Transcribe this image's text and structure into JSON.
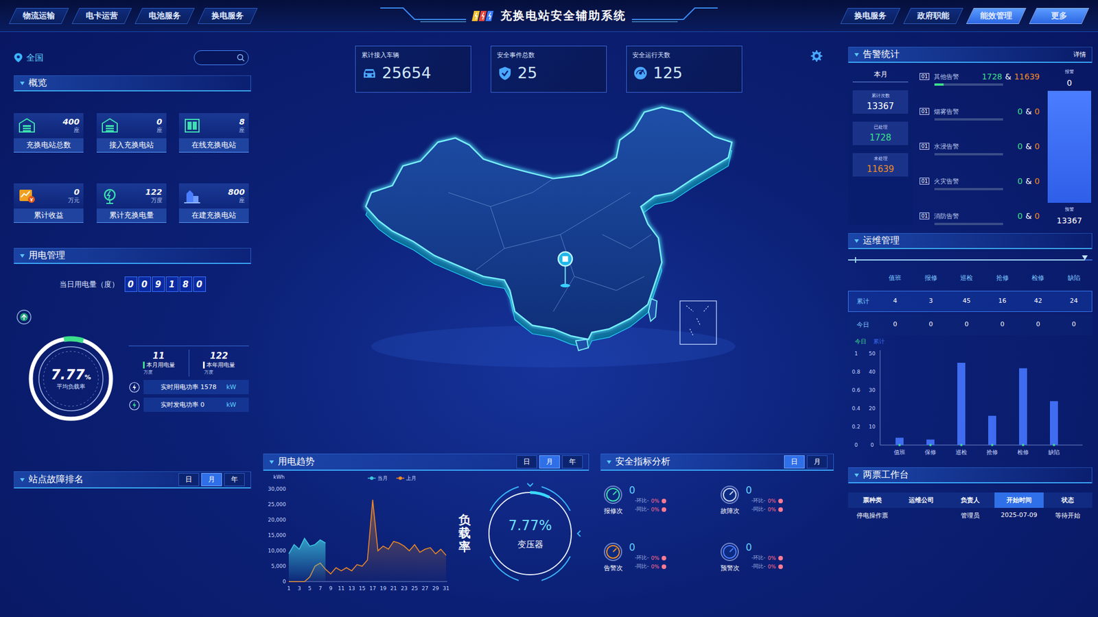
{
  "header": {
    "title": "充换电站安全辅助系统",
    "left_tabs": [
      {
        "label": "物流运输",
        "selected": false
      },
      {
        "label": "电卡运营",
        "selected": false
      },
      {
        "label": "电池服务",
        "selected": false
      },
      {
        "label": "换电服务",
        "selected": false
      }
    ],
    "right_tabs": [
      {
        "label": "换电服务",
        "selected": false
      },
      {
        "label": "政府职能",
        "selected": false
      },
      {
        "label": "能效管理",
        "selected": true
      },
      {
        "label": "更多",
        "selected": true
      }
    ]
  },
  "location": {
    "label": "全国"
  },
  "overview": {
    "title": "概览",
    "cards": [
      {
        "value": "400",
        "unit": "座",
        "label": "充换电站总数"
      },
      {
        "value": "0",
        "unit": "座",
        "label": "接入充换电站"
      },
      {
        "value": "8",
        "unit": "座",
        "label": "在线充换电站"
      },
      {
        "value": "0",
        "unit": "万元",
        "label": "累计收益"
      },
      {
        "value": "122",
        "unit": "万度",
        "label": "累计充换电量"
      },
      {
        "value": "800",
        "unit": "座",
        "label": "在建充换电站"
      }
    ]
  },
  "power": {
    "title": "用电管理",
    "daily_label": "当日用电量（度）",
    "digits": [
      "0",
      "0",
      "9",
      "1",
      "8",
      "0"
    ],
    "gauge": {
      "value": "7.77",
      "unit": "%",
      "label": "平均负载率",
      "level": 0.0777
    },
    "month": {
      "value": "11",
      "label": "本月用电量",
      "unit": "万度"
    },
    "year": {
      "value": "122",
      "label": "本年用电量",
      "unit": "万度"
    },
    "realtime": [
      {
        "label": "实时用电功率 1578",
        "unit": "kW"
      },
      {
        "label": "实时发电功率 0",
        "unit": "kW"
      }
    ]
  },
  "fault_rank": {
    "title": "站点故障排名",
    "tabs": [
      {
        "label": "日",
        "selected": false
      },
      {
        "label": "月",
        "selected": true
      },
      {
        "label": "年",
        "selected": false
      }
    ]
  },
  "stats": [
    {
      "label": "累计接入车辆",
      "value": "25654"
    },
    {
      "label": "安全事件总数",
      "value": "25"
    },
    {
      "label": "安全运行天数",
      "value": "125"
    }
  ],
  "trend": {
    "title": "用电趋势",
    "tabs": [
      {
        "label": "日",
        "selected": false
      },
      {
        "label": "月",
        "selected": true
      },
      {
        "label": "年",
        "selected": false
      }
    ],
    "unit": "kWh",
    "y_ticks": [
      "30,000",
      "25,000",
      "20,000",
      "15,000",
      "10,000",
      "5,000",
      "0"
    ],
    "x_ticks": [
      "1",
      "3",
      "5",
      "7",
      "9",
      "11",
      "13",
      "15",
      "17",
      "19",
      "21",
      "23",
      "25",
      "27",
      "29",
      "31"
    ],
    "series": [
      {
        "name": "当月",
        "color": "#3ec6e0",
        "values": [
          9000,
          12000,
          10500,
          14000,
          11500,
          12000,
          13500,
          12500
        ]
      },
      {
        "name": "上月",
        "color": "#f08a24",
        "values": [
          0,
          0,
          0,
          0,
          1500,
          5000,
          6000,
          4000,
          2500,
          4500,
          3500,
          4500,
          3500,
          5500,
          5000,
          7000,
          26500,
          10000,
          11500,
          10500,
          13000,
          12500,
          11500,
          10000,
          12000,
          9500,
          10500,
          11000,
          9000,
          10500,
          8500
        ]
      }
    ],
    "load_title": "负载率",
    "load_value": "7.77%",
    "load_label": "变压器",
    "load_level": 0.0777
  },
  "safety": {
    "title": "安全指标分析",
    "tabs": [
      {
        "label": "日",
        "selected": true
      },
      {
        "label": "月",
        "selected": false
      }
    ],
    "items": [
      {
        "value": "0",
        "label": "报修次",
        "mom_label": "-环比-",
        "mom": "0%",
        "yoy_label": "-同比-",
        "yoy": "0%"
      },
      {
        "value": "0",
        "label": "故障次",
        "mom_label": "-环比-",
        "mom": "0%",
        "yoy_label": "-同比-",
        "yoy": "0%"
      },
      {
        "value": "0",
        "label": "告警次",
        "mom_label": "-环比-",
        "mom": "0%",
        "yoy_label": "-同比-",
        "yoy": "0%"
      },
      {
        "value": "0",
        "label": "预警次",
        "mom_label": "-环比-",
        "mom": "0%",
        "yoy_label": "-同比-",
        "yoy": "0%"
      }
    ]
  },
  "alarm": {
    "title": "告警统计",
    "detail": "详情",
    "period": "本月",
    "summary": [
      {
        "label": "累计次数",
        "value": "13367",
        "color": "#ffffff"
      },
      {
        "label": "已处理",
        "value": "1728",
        "color": "#3de08a"
      },
      {
        "label": "未处理",
        "value": "11639",
        "color": "#f08a24"
      }
    ],
    "items": [
      {
        "rank": "01",
        "name": "其他告警",
        "handled": "1728",
        "sep": "&",
        "pending": "11639",
        "level": 0.13
      },
      {
        "rank": "01",
        "name": "烟雾告警",
        "handled": "0",
        "sep": "&",
        "pending": "0",
        "level": 0
      },
      {
        "rank": "01",
        "name": "水浸告警",
        "handled": "0",
        "sep": "&",
        "pending": "0",
        "level": 0
      },
      {
        "rank": "01",
        "name": "火灾告警",
        "handled": "0",
        "sep": "&",
        "pending": "0",
        "level": 0
      },
      {
        "rank": "01",
        "name": "消防告警",
        "handled": "0",
        "sep": "&",
        "pending": "0",
        "level": 0
      }
    ],
    "gauge": {
      "top_label": "报警",
      "top_value": "0",
      "bottom_label": "预警",
      "bottom_value": "13367",
      "level": 1
    }
  },
  "ops": {
    "title": "运维管理",
    "timeline": {
      "level": 0.97
    },
    "columns": [
      "值班",
      "报修",
      "巡检",
      "抢修",
      "检修",
      "缺陷"
    ],
    "rows": [
      {
        "label": "累计",
        "values": [
          "4",
          "3",
          "45",
          "16",
          "42",
          "24"
        ],
        "selected": true
      },
      {
        "label": "今日",
        "values": [
          "0",
          "0",
          "0",
          "0",
          "0",
          "0"
        ],
        "selected": false
      }
    ],
    "chart": {
      "legend": [
        {
          "label": "今日",
          "color": "#3de08a"
        },
        {
          "label": "累计",
          "color": "#3f6cf0"
        }
      ],
      "left_ticks": [
        "1",
        "0.8",
        "0.6",
        "0.4",
        "0.2",
        "0"
      ],
      "right_ticks": [
        "50",
        "40",
        "30",
        "20",
        "10",
        "0"
      ],
      "labels": [
        "值班",
        "保修",
        "巡检",
        "抢修",
        "检修",
        "缺陷"
      ],
      "today": [
        0,
        0,
        0,
        0,
        0,
        0
      ],
      "total": [
        4,
        3,
        45,
        16,
        42,
        24
      ]
    }
  },
  "tickets": {
    "title": "两票工作台",
    "columns": [
      {
        "label": "票种类",
        "selected": false
      },
      {
        "label": "运维公司",
        "selected": false
      },
      {
        "label": "负责人",
        "selected": false
      },
      {
        "label": "开始时间",
        "selected": true
      },
      {
        "label": "状态",
        "selected": false
      }
    ],
    "rows": [
      [
        "停电操作票",
        "",
        "管理员",
        "2025-07-09",
        "等待开始"
      ]
    ]
  }
}
